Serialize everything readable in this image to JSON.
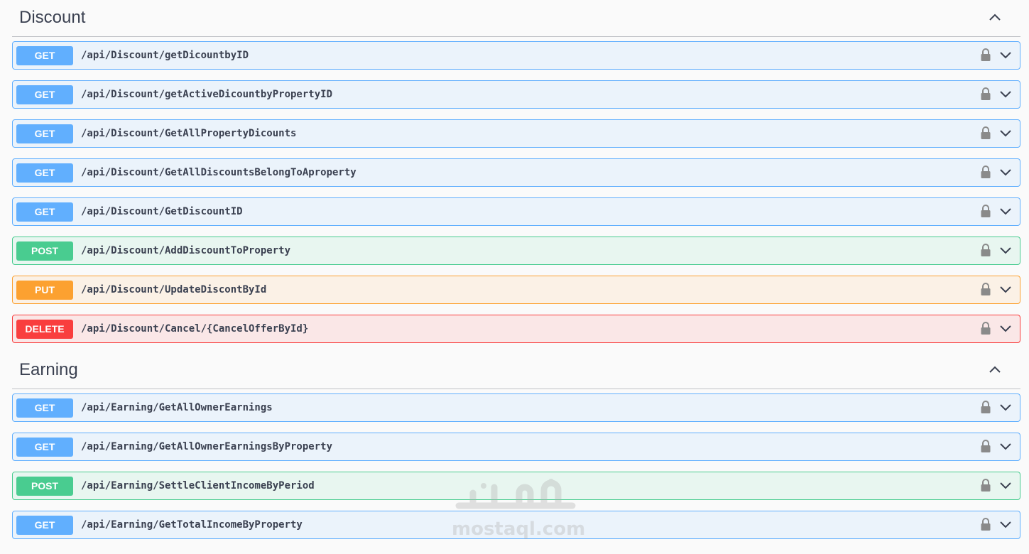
{
  "sections": [
    {
      "title": "Discount",
      "operations": [
        {
          "method": "GET",
          "path": "/api/Discount/getDicountbyID"
        },
        {
          "method": "GET",
          "path": "/api/Discount/getActiveDicountbyPropertyID"
        },
        {
          "method": "GET",
          "path": "/api/Discount/GetAllPropertyDicounts"
        },
        {
          "method": "GET",
          "path": "/api/Discount/GetAllDiscountsBelongToAproperty"
        },
        {
          "method": "GET",
          "path": "/api/Discount/GetDiscountID"
        },
        {
          "method": "POST",
          "path": "/api/Discount/AddDiscountToProperty"
        },
        {
          "method": "PUT",
          "path": "/api/Discount/UpdateDiscontById"
        },
        {
          "method": "DELETE",
          "path": "/api/Discount/Cancel/{CancelOfferById}"
        }
      ]
    },
    {
      "title": "Earning",
      "operations": [
        {
          "method": "GET",
          "path": "/api/Earning/GetAllOwnerEarnings"
        },
        {
          "method": "GET",
          "path": "/api/Earning/GetAllOwnerEarningsByProperty"
        },
        {
          "method": "POST",
          "path": "/api/Earning/SettleClientIncomeByPeriod"
        },
        {
          "method": "GET",
          "path": "/api/Earning/GetTotalIncomeByProperty"
        }
      ]
    }
  ],
  "watermark": {
    "text": "mostaql.com"
  },
  "colors": {
    "get": "#61affe",
    "post": "#49cc90",
    "put": "#fca130",
    "delete": "#f93e3e",
    "text": "#3b4151"
  },
  "icons": {
    "section_toggle": "chevron-up-icon",
    "operation_lock": "lock-icon",
    "operation_toggle": "chevron-down-icon"
  }
}
